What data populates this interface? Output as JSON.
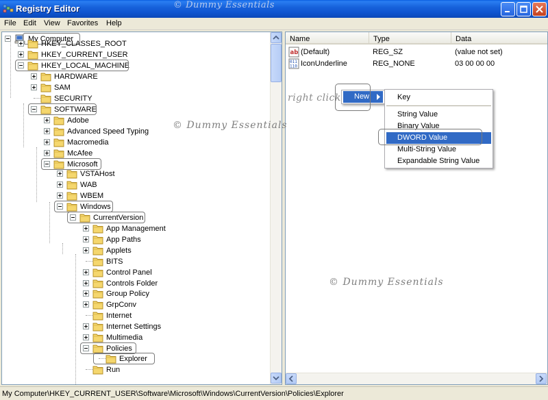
{
  "window": {
    "title": "Registry Editor",
    "watermark": "© Dummy Essentials"
  },
  "menu": [
    "File",
    "Edit",
    "View",
    "Favorites",
    "Help"
  ],
  "tree": {
    "root": "My Computer",
    "items": [
      {
        "label": "HKEY_CLASSES_ROOT"
      },
      {
        "label": "HKEY_CURRENT_USER"
      },
      {
        "label": "HKEY_LOCAL_MACHINE"
      },
      {
        "label": "HARDWARE"
      },
      {
        "label": "SAM"
      },
      {
        "label": "SECURITY"
      },
      {
        "label": "SOFTWARE"
      },
      {
        "label": "Adobe"
      },
      {
        "label": "Advanced Speed Typing"
      },
      {
        "label": "Macromedia"
      },
      {
        "label": "McAfee"
      },
      {
        "label": "Microsoft"
      },
      {
        "label": "VSTAHost"
      },
      {
        "label": "WAB"
      },
      {
        "label": "WBEM"
      },
      {
        "label": "Windows"
      },
      {
        "label": "CurrentVersion"
      },
      {
        "label": "App Management"
      },
      {
        "label": "App Paths"
      },
      {
        "label": "Applets"
      },
      {
        "label": "BITS"
      },
      {
        "label": "Control Panel"
      },
      {
        "label": "Controls Folder"
      },
      {
        "label": "Group Policy"
      },
      {
        "label": "GrpConv"
      },
      {
        "label": "Internet"
      },
      {
        "label": "Internet Settings"
      },
      {
        "label": "Multimedia"
      },
      {
        "label": "Policies"
      },
      {
        "label": "Explorer"
      },
      {
        "label": "Run"
      }
    ]
  },
  "list": {
    "columns": {
      "name": "Name",
      "type": "Type",
      "data": "Data"
    },
    "rows": [
      {
        "name": "(Default)",
        "type": "REG_SZ",
        "data": "(value not set)"
      },
      {
        "name": "IconUnderline",
        "type": "REG_NONE",
        "data": "03 00 00 00"
      }
    ],
    "hint": "right click"
  },
  "context_menu": {
    "new_label": "New",
    "submenu": [
      "Key",
      "String Value",
      "Binary Value",
      "DWORD Value",
      "Multi-String Value",
      "Expandable String Value"
    ],
    "selected": "DWORD Value"
  },
  "watermarks": [
    "© Dummy Essentials",
    "© Dummy Essentials"
  ],
  "status": {
    "path": "My Computer\\HKEY_CURRENT_USER\\Software\\Microsoft\\Windows\\CurrentVersion\\Policies\\Explorer"
  },
  "colors": {
    "titlebar": "#0f55d0",
    "selection": "#316ac5",
    "pane_border": "#7f9db9"
  }
}
